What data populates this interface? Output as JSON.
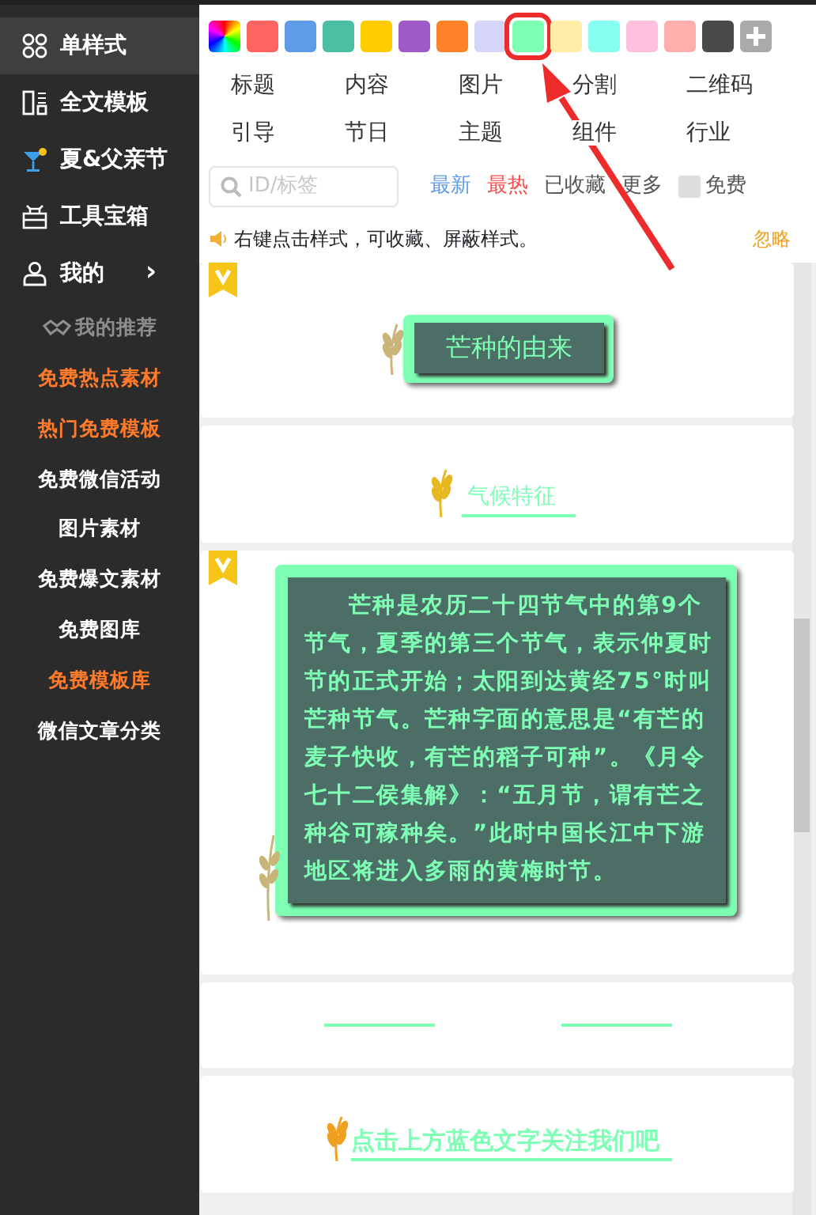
{
  "sidebar": {
    "items": [
      {
        "label": "单样式",
        "selected": true
      },
      {
        "label": "全文模板",
        "selected": false
      },
      {
        "label": "夏&父亲节",
        "selected": false
      },
      {
        "label": "工具宝箱",
        "selected": false
      },
      {
        "label": "我的",
        "selected": false,
        "chevron": "›"
      }
    ],
    "sub_header": {
      "label": "我的推荐"
    },
    "sub_items": [
      {
        "label": "免费热点素材",
        "highlight": true
      },
      {
        "label": "热门免费模板",
        "highlight": true
      },
      {
        "label": "免费微信活动",
        "highlight": false
      },
      {
        "label": "图片素材",
        "highlight": false
      },
      {
        "label": "免费爆文素材",
        "highlight": false
      },
      {
        "label": "免费图库",
        "highlight": false
      },
      {
        "label": "免费模板库",
        "highlight": true
      },
      {
        "label": "微信文章分类",
        "highlight": false
      }
    ]
  },
  "swatches": [
    {
      "kind": "rainbow"
    },
    {
      "kind": "color",
      "color": "#ff6461",
      "selected": false
    },
    {
      "kind": "color",
      "color": "#5f9ce8",
      "selected": false
    },
    {
      "kind": "color",
      "color": "#4bbfa3",
      "selected": false
    },
    {
      "kind": "color",
      "color": "#ffcc00",
      "selected": false
    },
    {
      "kind": "color",
      "color": "#a05ac8",
      "selected": false
    },
    {
      "kind": "color",
      "color": "#ff8228",
      "selected": false
    },
    {
      "kind": "color",
      "color": "#d5d5fa",
      "selected": false
    },
    {
      "kind": "color",
      "color": "#7dffb4",
      "selected": true
    },
    {
      "kind": "color",
      "color": "#ffeca6",
      "selected": false
    },
    {
      "kind": "color",
      "color": "#85fff0",
      "selected": false
    },
    {
      "kind": "color",
      "color": "#ffc0de",
      "selected": false
    },
    {
      "kind": "color",
      "color": "#ffadad",
      "selected": false
    },
    {
      "kind": "color",
      "color": "#4a4a4a",
      "selected": false
    },
    {
      "kind": "add"
    }
  ],
  "categories": [
    [
      "标题",
      "内容",
      "图片",
      "分割",
      "二维码"
    ],
    [
      "引导",
      "节日",
      "主题",
      "组件",
      "行业"
    ]
  ],
  "search": {
    "placeholder": "ID/标签"
  },
  "filters": [
    {
      "label": "最新",
      "color": "#5f9ce8"
    },
    {
      "label": "最热",
      "color": "#ff4d4d"
    },
    {
      "label": "已收藏",
      "color": "#555555"
    },
    {
      "label": "更多",
      "color": "#555555"
    }
  ],
  "free_checkbox": {
    "label": "免费",
    "checked": false
  },
  "notice": {
    "text": "右键点击样式，可收藏、屏蔽样式。",
    "dismiss": "忽略"
  },
  "cards": [
    {
      "kind": "title_box",
      "badge": true,
      "text": "芒种的由来"
    },
    {
      "kind": "underline_title",
      "badge": false,
      "text": "气候特征"
    },
    {
      "kind": "paragraph_box",
      "badge": true,
      "text": "芒种是农历二十四节气中的第9个节气，夏季的第三个节气，表示仲夏时节的正式开始；太阳到达黄经75°时叫芒种节气。芒种字面的意思是“有芒的麦子快收，有芒的稻子可种”。《月令七十二侯集解》：“五月节，谓有芒之种谷可稼种矣。”此时中国长江中下游地区将进入多雨的黄梅时节。"
    },
    {
      "kind": "divider",
      "badge": false
    },
    {
      "kind": "banner_title",
      "badge": false,
      "text": "点击上方蓝色文字关注我们吧"
    }
  ]
}
